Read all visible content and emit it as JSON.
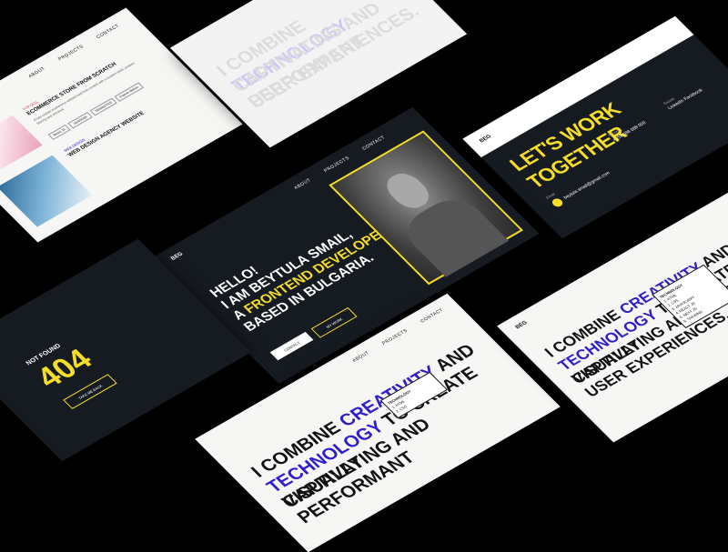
{
  "hero": {
    "logo": "BEG",
    "nav": [
      "ABOUT",
      "PROJECTS",
      "CONTACT"
    ],
    "line1": "HELLO!",
    "line2": "I AM BEYTULA SMAIL,",
    "line3_a": "A ",
    "line3_b": "FRONTEND DEVELOPER",
    "line4": "BASED IN BULGARIA.",
    "btn_contact": "CONTACT",
    "btn_projects": "MY WORK"
  },
  "notfound": {
    "label": "NOT FOUND",
    "code": "404",
    "button": "TAKE ME BACK"
  },
  "contact": {
    "logo": "BEG",
    "title": "LET'S WORK TOGETHER",
    "phone_label": "Phone",
    "phone": "+359 888 088 000",
    "social_label": "Socials",
    "social": "LinkedIn  Facebook",
    "email_label": "Email",
    "email": "beytula.smail@gmail.com"
  },
  "projects": {
    "nav": [
      "ABOUT",
      "PROJECTS",
      "CONTACT"
    ],
    "p1_tag": "TOP SELL",
    "p1_title": "ECOMMERCE STORE FROM SCRATCH",
    "p1_desc": "A fully custom ecommerce website built from scratch with a modern stack, product filtering and checkout.",
    "tags": [
      "React JS",
      "JavaScript",
      "Tailwind CSS",
      "Framer Motion"
    ],
    "p2_tag": "WEB DESIGN",
    "p2_title": "WEB DESIGN AGENCY WEBSITE"
  },
  "about": {
    "logo": "BEG",
    "line1_a": "I COMBINE ",
    "line1_b": "CREATIVITY",
    "line1_c": " AND",
    "line2_a": "TECHNOLOGY",
    "line2_b": " TO CREATE VISUALLY",
    "line3": "CAPTIVATING AND PERFORMANT",
    "line4": "USER EXPERIENCES.",
    "tech_title": "TECHNOLOGY",
    "tech_items": [
      "1. HTML",
      "2. CSS",
      "3. JAVASCRIPT",
      "4. REACT JS",
      "5. NEXT JS",
      "6. TAILWIND"
    ]
  },
  "colors": {
    "accent": "#f5dd28",
    "dark": "#161b22",
    "blue": "#2e20c9"
  }
}
